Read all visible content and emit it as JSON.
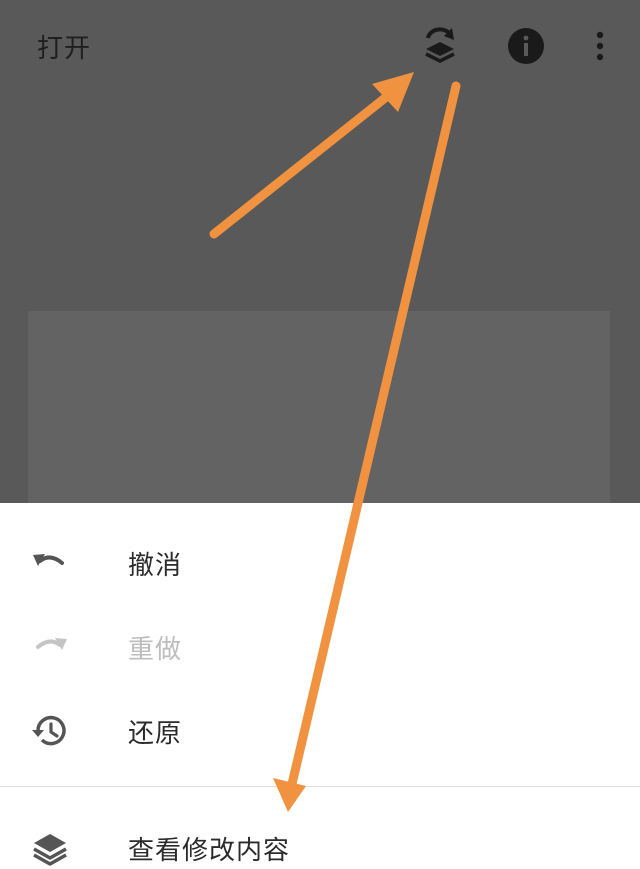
{
  "top_bar": {
    "open_label": "打开",
    "icons": [
      "layers-undo-icon",
      "info-icon",
      "more-vert-icon"
    ]
  },
  "menu": {
    "items": [
      {
        "label": "撤消",
        "icon": "undo-icon",
        "enabled": true
      },
      {
        "label": "重做",
        "icon": "redo-icon",
        "enabled": false
      },
      {
        "label": "还原",
        "icon": "history-icon",
        "enabled": true
      },
      {
        "label": "查看修改内容",
        "icon": "layers-icon",
        "enabled": true
      }
    ]
  },
  "colors": {
    "background": "#595959",
    "image_area": "#636363",
    "sheet": "#ffffff",
    "annotation_arrow": "#f0923f",
    "disabled_text": "#bdbdbd"
  }
}
